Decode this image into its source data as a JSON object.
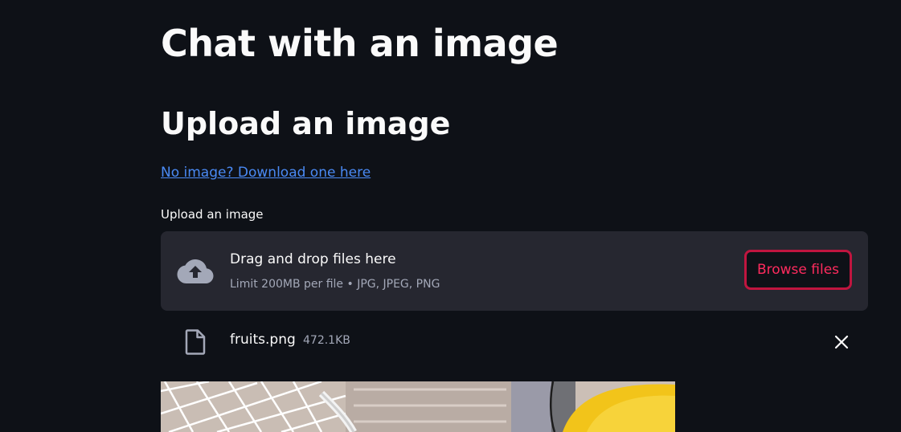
{
  "page": {
    "title": "Chat with an image",
    "subheader": "Upload an image",
    "download_link": "No image? Download one here"
  },
  "uploader": {
    "label": "Upload an image",
    "instructions": "Drag and drop files here",
    "limit_text": "Limit 200MB per file • JPG, JPEG, PNG",
    "browse_label": "Browse files",
    "cloud_icon": "cloud-upload-icon"
  },
  "uploaded_file": {
    "name": "fruits.png",
    "size": "472.1KB",
    "file_icon": "file-icon",
    "remove_icon": "close-icon"
  },
  "colors": {
    "background": "#0e1117",
    "panel": "#262730",
    "accent": "#ff2b5e",
    "link": "#4a8af4",
    "muted_text": "#a3a8b8"
  }
}
